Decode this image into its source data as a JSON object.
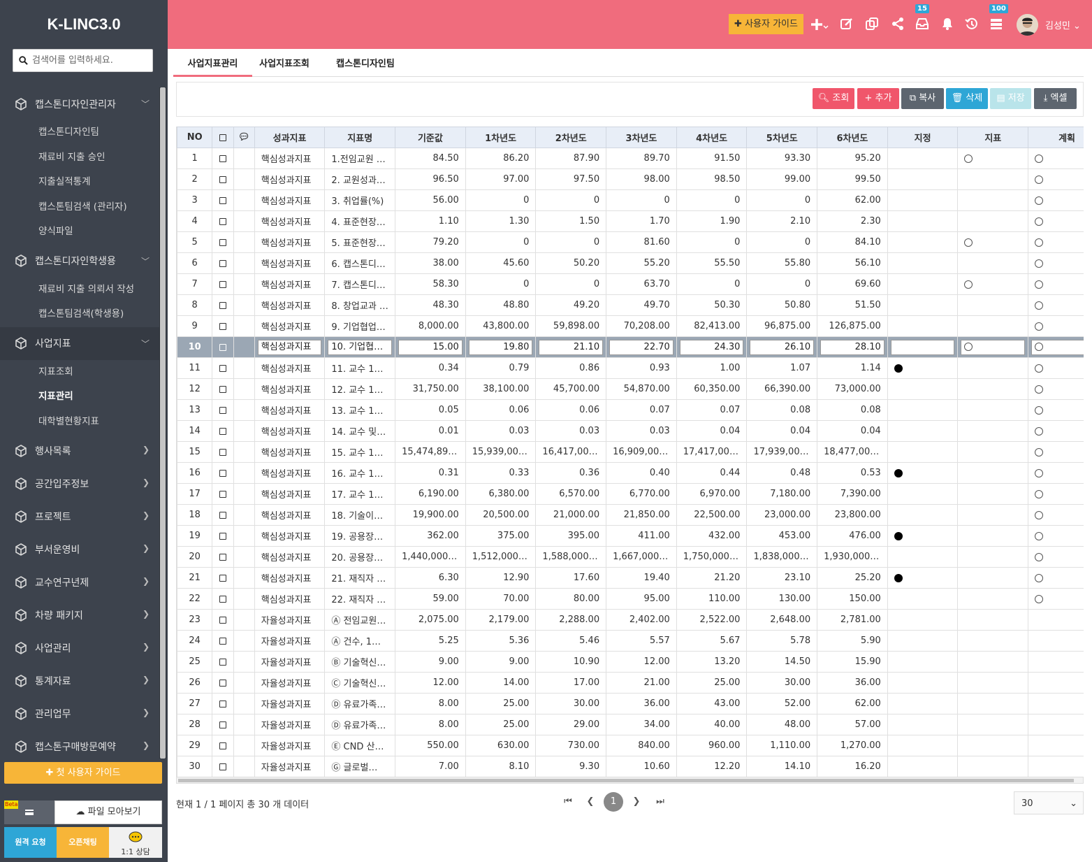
{
  "app": {
    "logo": "K-LINC3.0"
  },
  "search": {
    "placeholder": "검색어를 입력하세요."
  },
  "sidebar": {
    "groups": [
      {
        "label": "캡스톤디자인관리자",
        "subs": [
          "캡스톤디자인팀",
          "재료비 지출 승인",
          "지출실적통계",
          "캡스톤팀검색 (관리자)",
          "양식파일"
        ]
      },
      {
        "label": "캡스톤디자인학생용",
        "subs": [
          "재료비 지출 의뢰서 작성",
          "캡스톤팀검색(학생용)"
        ]
      },
      {
        "label": "사업지표",
        "subs": [
          "지표조회",
          "지표관리",
          "대학별현황지표"
        ]
      },
      {
        "label": "행사목록"
      },
      {
        "label": "공간입주정보"
      },
      {
        "label": "프로젝트"
      },
      {
        "label": "부서운영비"
      },
      {
        "label": "교수연구년제"
      },
      {
        "label": "차량 패키지"
      },
      {
        "label": "사업관리"
      },
      {
        "label": "통계자료"
      },
      {
        "label": "관리업무"
      },
      {
        "label": "캡스톤구매방문예약"
      }
    ],
    "guide_button": "첫 사용자 가이드",
    "beta": "Beta",
    "files_button": "파일 모아보기",
    "remote_button": "원격 요청",
    "openchat_button": "오픈채팅",
    "consult_button": "1:1 상담"
  },
  "topbar": {
    "user_guide": "사용자 가이드",
    "badge_inbox": "15",
    "badge_list": "100",
    "user_name": "김성민"
  },
  "tabs": [
    "사업지표관리",
    "사업지표조회",
    "캡스톤디자인팀"
  ],
  "toolbar": {
    "search": "조회",
    "add": "추가",
    "copy": "복사",
    "delete": "삭제",
    "save": "저장",
    "excel": "엑셀"
  },
  "grid": {
    "columns": [
      "NO",
      "",
      "",
      "성과지표",
      "지표명",
      "기준값",
      "1차년도",
      "2차년도",
      "3차년도",
      "4차년도",
      "5차년도",
      "6차년도",
      "지정",
      "지표",
      "계획"
    ],
    "rows": [
      [
        "1",
        "핵심성과지표",
        "1.전임교원 …",
        "84.50",
        "86.20",
        "87.90",
        "89.70",
        "91.50",
        "93.30",
        "95.20",
        "",
        "o",
        "o"
      ],
      [
        "2",
        "핵심성과지표",
        "2. 교원성과…",
        "96.50",
        "97.00",
        "97.50",
        "98.00",
        "98.50",
        "99.00",
        "99.50",
        "",
        "",
        "o"
      ],
      [
        "3",
        "핵심성과지표",
        "3. 취업률(%)",
        "56.00",
        "0",
        "0",
        "0",
        "0",
        "0",
        "62.00",
        "",
        "",
        "o"
      ],
      [
        "4",
        "핵심성과지표",
        "4. 표준현장…",
        "1.10",
        "1.30",
        "1.50",
        "1.70",
        "1.90",
        "2.10",
        "2.30",
        "",
        "",
        "o"
      ],
      [
        "5",
        "핵심성과지표",
        "5. 표준현장…",
        "79.20",
        "0",
        "0",
        "81.60",
        "0",
        "0",
        "84.10",
        "",
        "o",
        "o"
      ],
      [
        "6",
        "핵심성과지표",
        "6. 캡스톤디…",
        "38.00",
        "45.60",
        "50.20",
        "55.20",
        "55.50",
        "55.80",
        "56.10",
        "",
        "",
        "o"
      ],
      [
        "7",
        "핵심성과지표",
        "7. 캡스톤디…",
        "58.30",
        "0",
        "0",
        "63.70",
        "0",
        "0",
        "69.60",
        "",
        "o",
        "o"
      ],
      [
        "8",
        "핵심성과지표",
        "8. 창업교과 …",
        "48.30",
        "48.80",
        "49.20",
        "49.70",
        "50.30",
        "50.80",
        "51.50",
        "",
        "",
        "o"
      ],
      [
        "9",
        "핵심성과지표",
        "9. 기업협업…",
        "8,000.00",
        "43,800.00",
        "59,898.00",
        "70,208.00",
        "82,413.00",
        "96,875.00",
        "126,875.00",
        "",
        "",
        "o"
      ],
      [
        "10",
        "핵심성과지표",
        "10. 기업협…",
        "15.00",
        "19.80",
        "21.10",
        "22.70",
        "24.30",
        "26.10",
        "28.10",
        "",
        "o",
        "o"
      ],
      [
        "11",
        "핵심성과지표",
        "11. 교수 1…",
        "0.34",
        "0.79",
        "0.86",
        "0.93",
        "1.00",
        "1.07",
        "1.14",
        "●",
        "",
        "o"
      ],
      [
        "12",
        "핵심성과지표",
        "12. 교수 1…",
        "31,750.00",
        "38,100.00",
        "45,700.00",
        "54,870.00",
        "60,350.00",
        "66,390.00",
        "73,000.00",
        "",
        "",
        "o"
      ],
      [
        "13",
        "핵심성과지표",
        "13. 교수 1…",
        "0.05",
        "0.06",
        "0.06",
        "0.07",
        "0.07",
        "0.08",
        "0.08",
        "",
        "",
        "o"
      ],
      [
        "14",
        "핵심성과지표",
        "14. 교수 및 …",
        "0.01",
        "0.03",
        "0.03",
        "0.03",
        "0.04",
        "0.04",
        "0.04",
        "",
        "",
        "o"
      ],
      [
        "15",
        "핵심성과지표",
        "15. 교수 1…",
        "15,474,895…",
        "15,939,000…",
        "16,417,000…",
        "16,909,000…",
        "17,417,000…",
        "17,939,000…",
        "18,477,000…",
        "",
        "",
        "o"
      ],
      [
        "16",
        "핵심성과지표",
        "16. 교수 1…",
        "0.31",
        "0.33",
        "0.36",
        "0.40",
        "0.44",
        "0.48",
        "0.53",
        "●",
        "",
        "o"
      ],
      [
        "17",
        "핵심성과지표",
        "17. 교수 1…",
        "6,190.00",
        "6,380.00",
        "6,570.00",
        "6,770.00",
        "6,970.00",
        "7,180.00",
        "7,390.00",
        "",
        "",
        "o"
      ],
      [
        "18",
        "핵심성과지표",
        "18. 기술이…",
        "19,900.00",
        "20,500.00",
        "21,000.00",
        "21,850.00",
        "22,500.00",
        "23,000.00",
        "23,800.00",
        "",
        "",
        "o"
      ],
      [
        "19",
        "핵심성과지표",
        "19. 공용장…",
        "362.00",
        "375.00",
        "395.00",
        "411.00",
        "432.00",
        "453.00",
        "476.00",
        "●",
        "",
        "o"
      ],
      [
        "20",
        "핵심성과지표",
        "20. 공용장…",
        "1,440,000.00",
        "1,512,000.00",
        "1,588,000.00",
        "1,667,000.00",
        "1,750,000.00",
        "1,838,000.00",
        "1,930,000.00",
        "",
        "",
        "o"
      ],
      [
        "21",
        "핵심성과지표",
        "21. 재직자 …",
        "6.30",
        "12.90",
        "17.60",
        "19.40",
        "21.20",
        "23.10",
        "25.20",
        "●",
        "",
        "o"
      ],
      [
        "22",
        "핵심성과지표",
        "22. 재직자 …",
        "59.00",
        "70.00",
        "80.00",
        "95.00",
        "110.00",
        "130.00",
        "150.00",
        "",
        "",
        "o"
      ],
      [
        "23",
        "자율성과지표",
        "Ⓐ 전임교원…",
        "2,075.00",
        "2,179.00",
        "2,288.00",
        "2,402.00",
        "2,522.00",
        "2,648.00",
        "2,781.00",
        "",
        "",
        ""
      ],
      [
        "24",
        "자율성과지표",
        "Ⓐ 건수, 1…",
        "5.25",
        "5.36",
        "5.46",
        "5.57",
        "5.67",
        "5.78",
        "5.90",
        "",
        "",
        ""
      ],
      [
        "25",
        "자율성과지표",
        "Ⓑ 기술혁신…",
        "9.00",
        "9.00",
        "10.90",
        "12.00",
        "13.20",
        "14.50",
        "15.90",
        "",
        "",
        ""
      ],
      [
        "26",
        "자율성과지표",
        "Ⓒ 기술혁신…",
        "12.00",
        "14.00",
        "17.00",
        "21.00",
        "25.00",
        "30.00",
        "36.00",
        "",
        "",
        ""
      ],
      [
        "27",
        "자율성과지표",
        "Ⓓ 유료가족…",
        "8.00",
        "25.00",
        "30.00",
        "36.00",
        "43.00",
        "52.00",
        "62.00",
        "",
        "",
        ""
      ],
      [
        "28",
        "자율성과지표",
        "Ⓓ 유료가족…",
        "8.00",
        "25.00",
        "29.00",
        "34.00",
        "40.00",
        "48.00",
        "57.00",
        "",
        "",
        ""
      ],
      [
        "29",
        "자율성과지표",
        "Ⓔ CND 산…",
        "550.00",
        "630.00",
        "730.00",
        "840.00",
        "960.00",
        "1,110.00",
        "1,270.00",
        "",
        "",
        ""
      ],
      [
        "30",
        "자율성과지표",
        "Ⓖ 글로벌…",
        "7.00",
        "8.10",
        "9.30",
        "10.60",
        "12.20",
        "14.10",
        "16.20",
        "",
        "",
        ""
      ]
    ],
    "selected_row": "10"
  },
  "pagination": {
    "info": "현재 1 / 1 페이지 총 30 개 데이터",
    "current": "1",
    "page_size": "30"
  },
  "colors": {
    "topbar": "#f06c7d",
    "sidebar": "#3d434d",
    "accent_blue": "#2ea6d6",
    "accent_yellow": "#f7b538"
  }
}
